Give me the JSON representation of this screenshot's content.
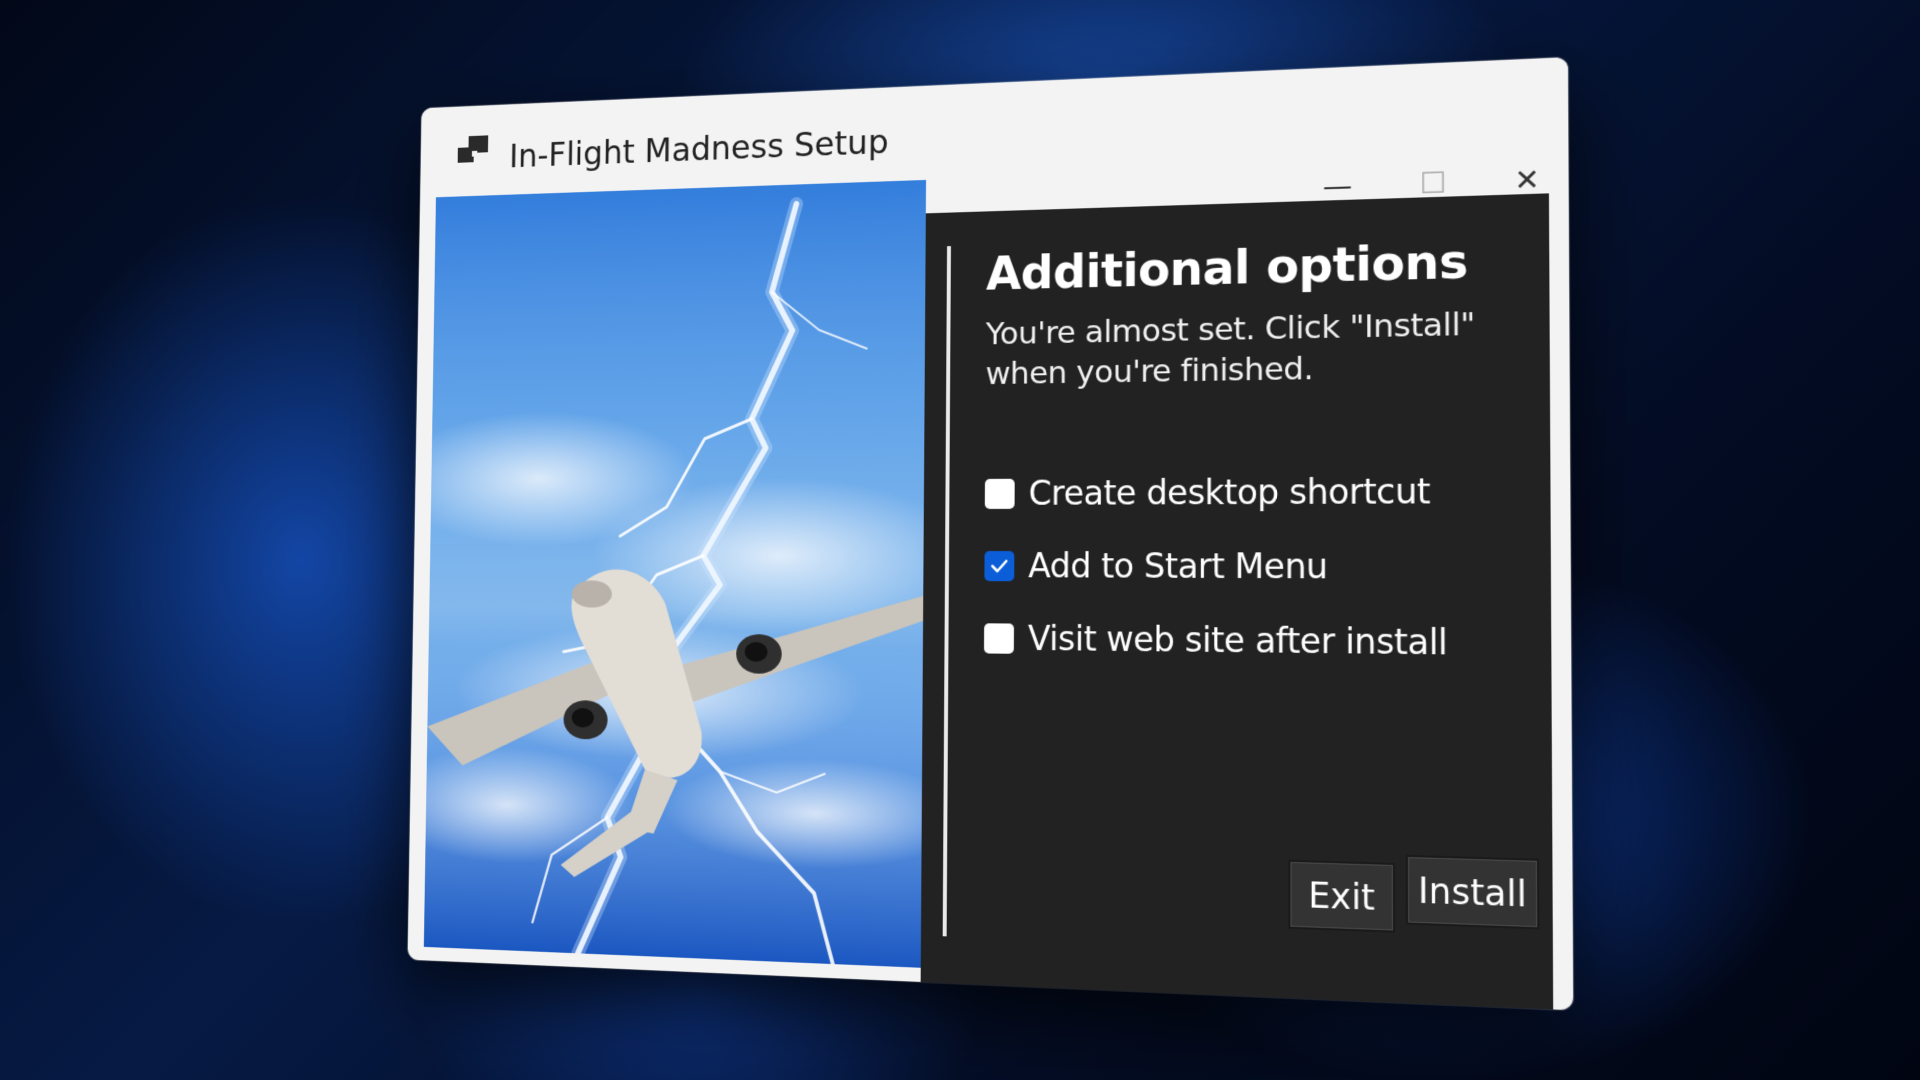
{
  "window": {
    "title": "In-Flight Madness Setup",
    "controls": {
      "minimize_icon": "minimize-icon",
      "maximize_icon": "maximize-icon",
      "close_icon": "close-icon",
      "minimize_glyph": "—",
      "maximize_glyph": "☐",
      "close_glyph": "✕"
    }
  },
  "hero": {
    "image": "airplane-lightning-sky"
  },
  "panel": {
    "heading": "Additional options",
    "subtitle": "You're almost set. Click \"Install\" when you're finished.",
    "options": [
      {
        "label": "Create desktop shortcut",
        "checked": false
      },
      {
        "label": "Add to Start Menu",
        "checked": true
      },
      {
        "label": "Visit web site after install",
        "checked": false
      }
    ],
    "buttons": {
      "exit": "Exit",
      "install": "Install"
    }
  },
  "colors": {
    "panel_bg": "#222222",
    "accent": "#0b5ed7",
    "titlebar_bg": "#f3f3f3"
  }
}
